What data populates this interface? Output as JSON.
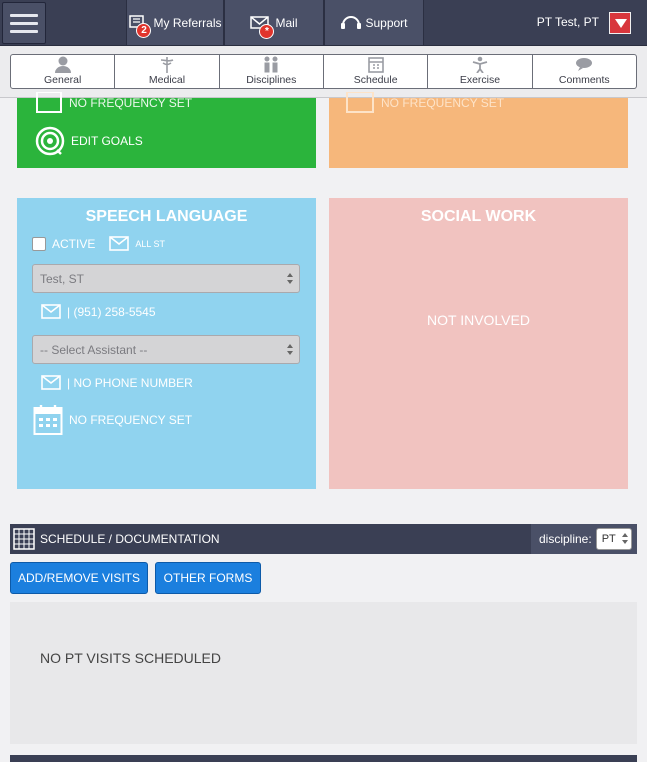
{
  "topbar": {
    "referrals_label": "My Referrals",
    "referrals_badge": "2",
    "mail_label": "Mail",
    "mail_badge": "*",
    "support_label": "Support",
    "user_name": "PT Test, PT"
  },
  "tabs": [
    {
      "label": "General",
      "icon": "person-icon"
    },
    {
      "label": "Medical",
      "icon": "caduceus-icon"
    },
    {
      "label": "Disciplines",
      "icon": "people-icon"
    },
    {
      "label": "Schedule",
      "icon": "calendar-icon"
    },
    {
      "label": "Exercise",
      "icon": "exercise-icon"
    },
    {
      "label": "Comments",
      "icon": "comment-icon"
    }
  ],
  "cards": {
    "top_left": {
      "frequency": "NO FREQUENCY SET",
      "edit_goals": "EDIT GOALS",
      "color": "#2bb43c"
    },
    "top_right": {
      "frequency": "NO FREQUENCY SET",
      "color": "#f6b77b"
    },
    "speech": {
      "title": "SPEECH LANGUAGE",
      "active_label": "ACTIVE",
      "all_label": "ALL ST",
      "therapist_select": "Test, ST",
      "therapist_phone": "| (951) 258-5545",
      "assistant_select": "-- Select Assistant --",
      "assistant_phone": "| NO PHONE NUMBER",
      "frequency": "NO FREQUENCY SET",
      "color": "#90d3ef"
    },
    "social": {
      "title": "SOCIAL WORK",
      "status": "NOT INVOLVED",
      "color": "#f1c3c0"
    }
  },
  "schedule": {
    "title": "SCHEDULE / DOCUMENTATION",
    "discipline_label": "discipline:",
    "discipline_value": "PT",
    "add_remove_button": "ADD/REMOVE VISITS",
    "other_forms_button": "OTHER FORMS",
    "empty_message": "NO PT VISITS SCHEDULED"
  }
}
